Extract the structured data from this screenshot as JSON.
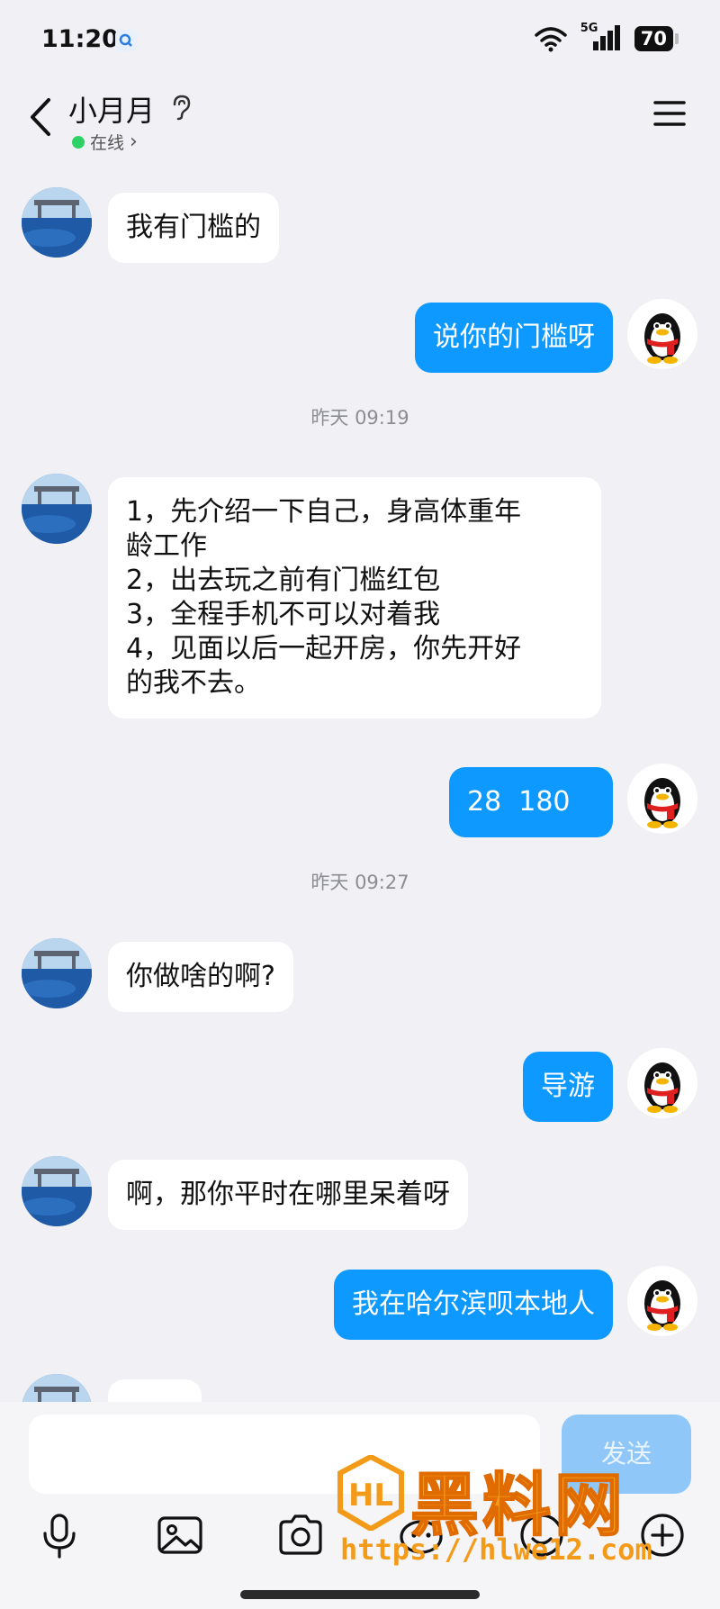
{
  "status_bar": {
    "time": "11:20",
    "network": "5G",
    "battery": "70"
  },
  "header": {
    "contact_name": "小月月",
    "status": "在线",
    "status_chevron": "›"
  },
  "messages": [
    {
      "dir": "in",
      "text": "我有门槛的"
    },
    {
      "dir": "out",
      "text": "说你的门槛呀"
    },
    {
      "type": "time",
      "text": "昨天 09:19"
    },
    {
      "dir": "in",
      "lines": [
        "1，先介绍一下自己，身高体重年",
        "龄工作",
        "2，出去玩之前有门槛红包",
        "3，全程手机不可以对着我",
        "4，见面以后一起开房，你先开好",
        "的我不去。"
      ]
    },
    {
      "dir": "out",
      "text": "28  180"
    },
    {
      "type": "time",
      "text": "昨天 09:27"
    },
    {
      "dir": "in",
      "text": "你做啥的啊?"
    },
    {
      "dir": "out",
      "text": "导游"
    },
    {
      "dir": "in",
      "text": "啊，那你平时在哪里呆着呀"
    },
    {
      "dir": "out",
      "text": "我在哈尔滨呗本地人"
    }
  ],
  "input": {
    "placeholder": "",
    "send_label": "发送"
  },
  "toolbar": [
    "mic-icon",
    "image-icon",
    "camera-icon",
    "emoji-icon",
    "sticker-icon",
    "plus-icon"
  ],
  "watermark": {
    "title": "黑料网",
    "url": "https://hlwe12.com"
  },
  "colors": {
    "outgoing_bubble": "#0d99ff",
    "incoming_bubble": "#ffffff",
    "background": "#f1f1f5",
    "online": "#2ed166"
  }
}
